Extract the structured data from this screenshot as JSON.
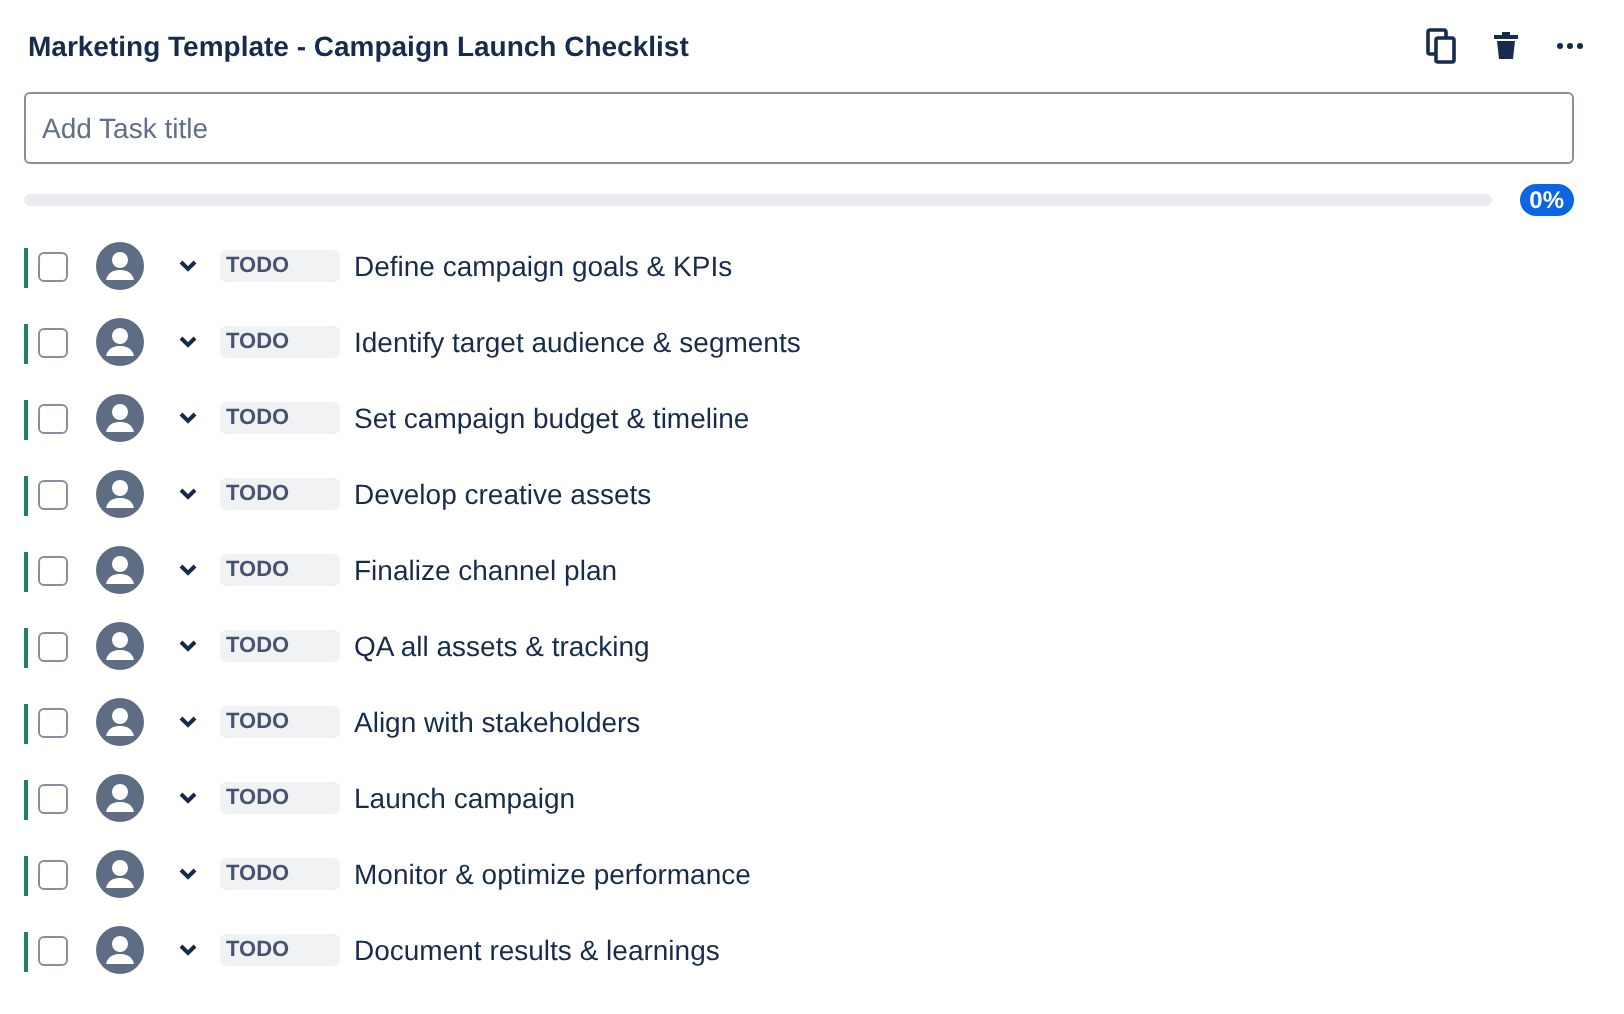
{
  "title": "Marketing Template - Campaign Launch Checklist",
  "new_task": {
    "placeholder": "Add Task title"
  },
  "progress": {
    "level": 0,
    "reading": "0%"
  },
  "tasks": [
    {
      "status": "TODO",
      "title": "Define campaign goals & KPIs",
      "checked": false
    },
    {
      "status": "TODO",
      "title": "Identify target audience & segments",
      "checked": false
    },
    {
      "status": "TODO",
      "title": "Set campaign budget & timeline",
      "checked": false
    },
    {
      "status": "TODO",
      "title": "Develop creative assets",
      "checked": false
    },
    {
      "status": "TODO",
      "title": "Finalize channel plan",
      "checked": false
    },
    {
      "status": "TODO",
      "title": "QA all assets & tracking",
      "checked": false
    },
    {
      "status": "TODO",
      "title": "Align with stakeholders",
      "checked": false
    },
    {
      "status": "TODO",
      "title": "Launch campaign",
      "checked": false
    },
    {
      "status": "TODO",
      "title": "Monitor & optimize performance",
      "checked": false
    },
    {
      "status": "TODO",
      "title": "Document results & learnings",
      "checked": false
    }
  ]
}
